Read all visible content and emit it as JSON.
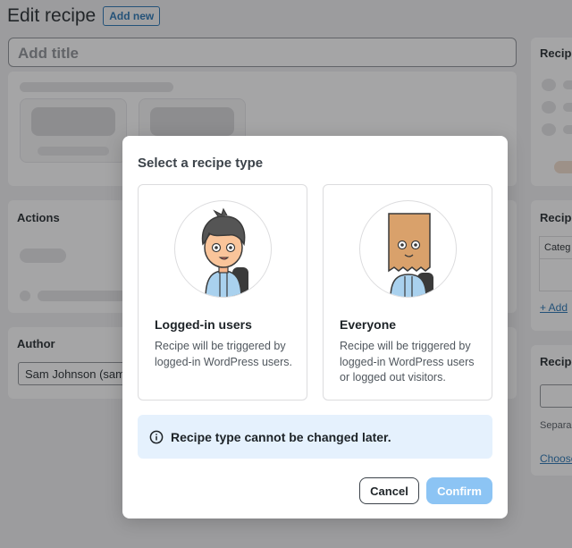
{
  "page": {
    "title": "Edit recipe",
    "add_new": "Add new",
    "title_placeholder": "Add title",
    "actions_heading": "Actions",
    "author_heading": "Author",
    "author_value": "Sam Johnson (samj",
    "side_recipe_heading_1": "Recipe",
    "side_recipe_heading_2": "Recipe",
    "side_recipe_heading_3": "Recipe",
    "side_category": "Categ",
    "side_add_link": "+ Add",
    "side_separate": "Separa",
    "side_choose": "Choose"
  },
  "modal": {
    "title": "Select a recipe type",
    "options": [
      {
        "title": "Logged-in users",
        "description": "Recipe will be triggered by logged-in WordPress users.",
        "icon": "person-avatar-icon"
      },
      {
        "title": "Everyone",
        "description": "Recipe will be triggered by logged-in WordPress users or logged out visitors.",
        "icon": "paper-bag-avatar-icon"
      }
    ],
    "notice": "Recipe type cannot be changed later.",
    "cancel_label": "Cancel",
    "confirm_label": "Confirm"
  },
  "colors": {
    "accent": "#2271b1",
    "confirm_disabled": "#8cc4f4",
    "notice_bg": "#e5f1fd"
  }
}
